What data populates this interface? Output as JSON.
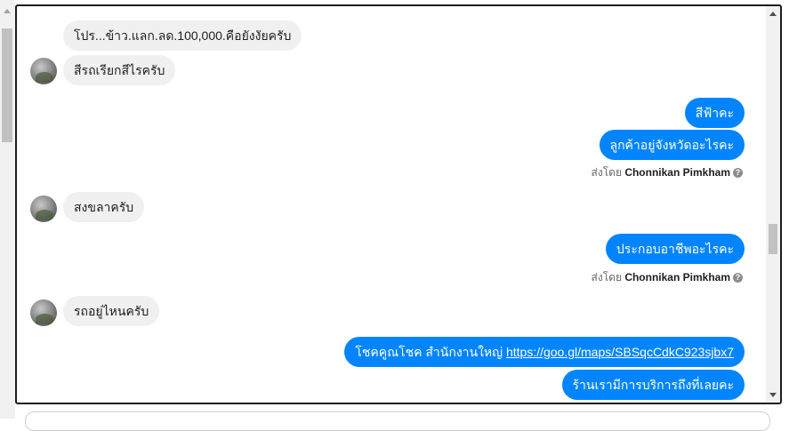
{
  "messages": {
    "m1": "โปร...ข้าว.แลก.ลด.100,000.คือยังงัยครับ",
    "m2": "สีรถเรียกสีไรครับ",
    "m3": "สีฟ้าคะ",
    "m4": "ลูกค้าอยู่จังหวัดอะไรคะ",
    "m5": "สงขลาครับ",
    "m6": "ประกอบอาชีพอะไรคะ",
    "m7": "รถอยู่ไหนครับ",
    "m8_text": "โชคคูณโชค สำนักงานใหญ่ ",
    "m8_link": "https://goo.gl/maps/SBSqcCdkC923sjbx7",
    "m9": "ร้านเรามีการบริการถึงที่เลยคะ"
  },
  "sent_by": {
    "prefix": "ส่งโดย ",
    "name": "Chonnikan Pimkham",
    "info_icon": "info-icon"
  }
}
